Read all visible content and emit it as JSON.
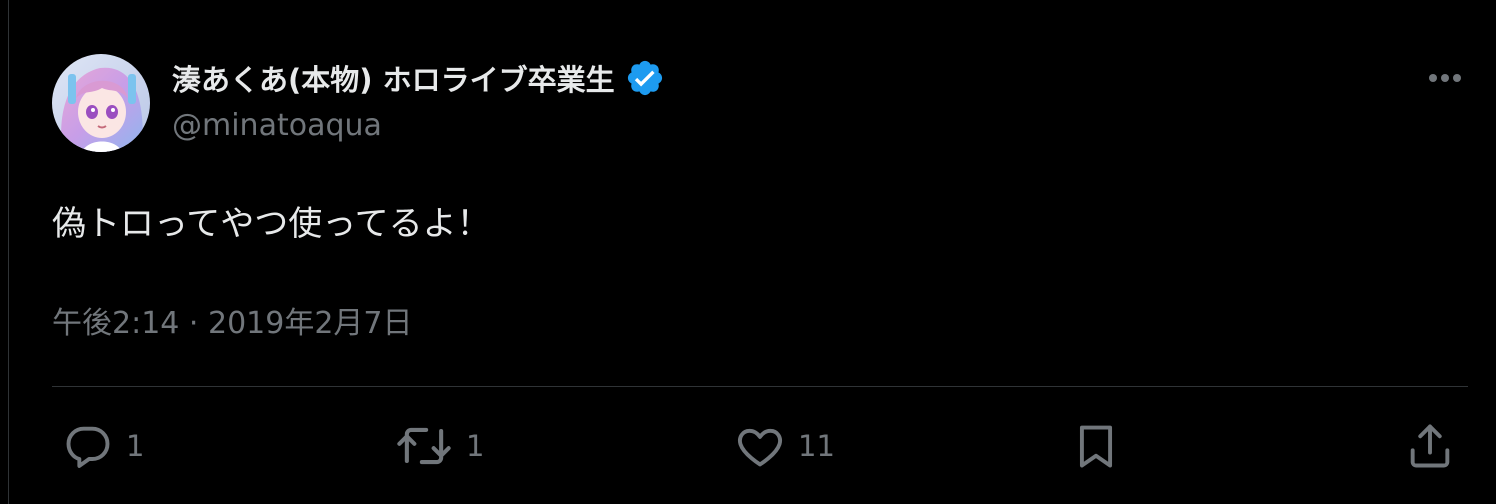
{
  "tweet": {
    "display_name": "湊あくあ(本物) ホロライブ卒業生",
    "handle": "@minatoaqua",
    "text": "偽トロってやつ使ってるよ！",
    "timestamp": "午後2:14 · 2019年2月7日",
    "verified": true,
    "verified_color": "#1d9bf0"
  },
  "actions": {
    "reply_count": "1",
    "retweet_count": "1",
    "like_count": "11"
  },
  "icons": {
    "avatar": "avatar-image",
    "verified": "verified-badge-icon",
    "more": "more-options-icon",
    "reply": "reply-icon",
    "retweet": "retweet-icon",
    "like": "heart-icon",
    "bookmark": "bookmark-icon",
    "share": "share-icon"
  },
  "colors": {
    "background": "#000000",
    "text_primary": "#e7e9ea",
    "text_secondary": "#71767b",
    "divider": "#2f3336"
  }
}
